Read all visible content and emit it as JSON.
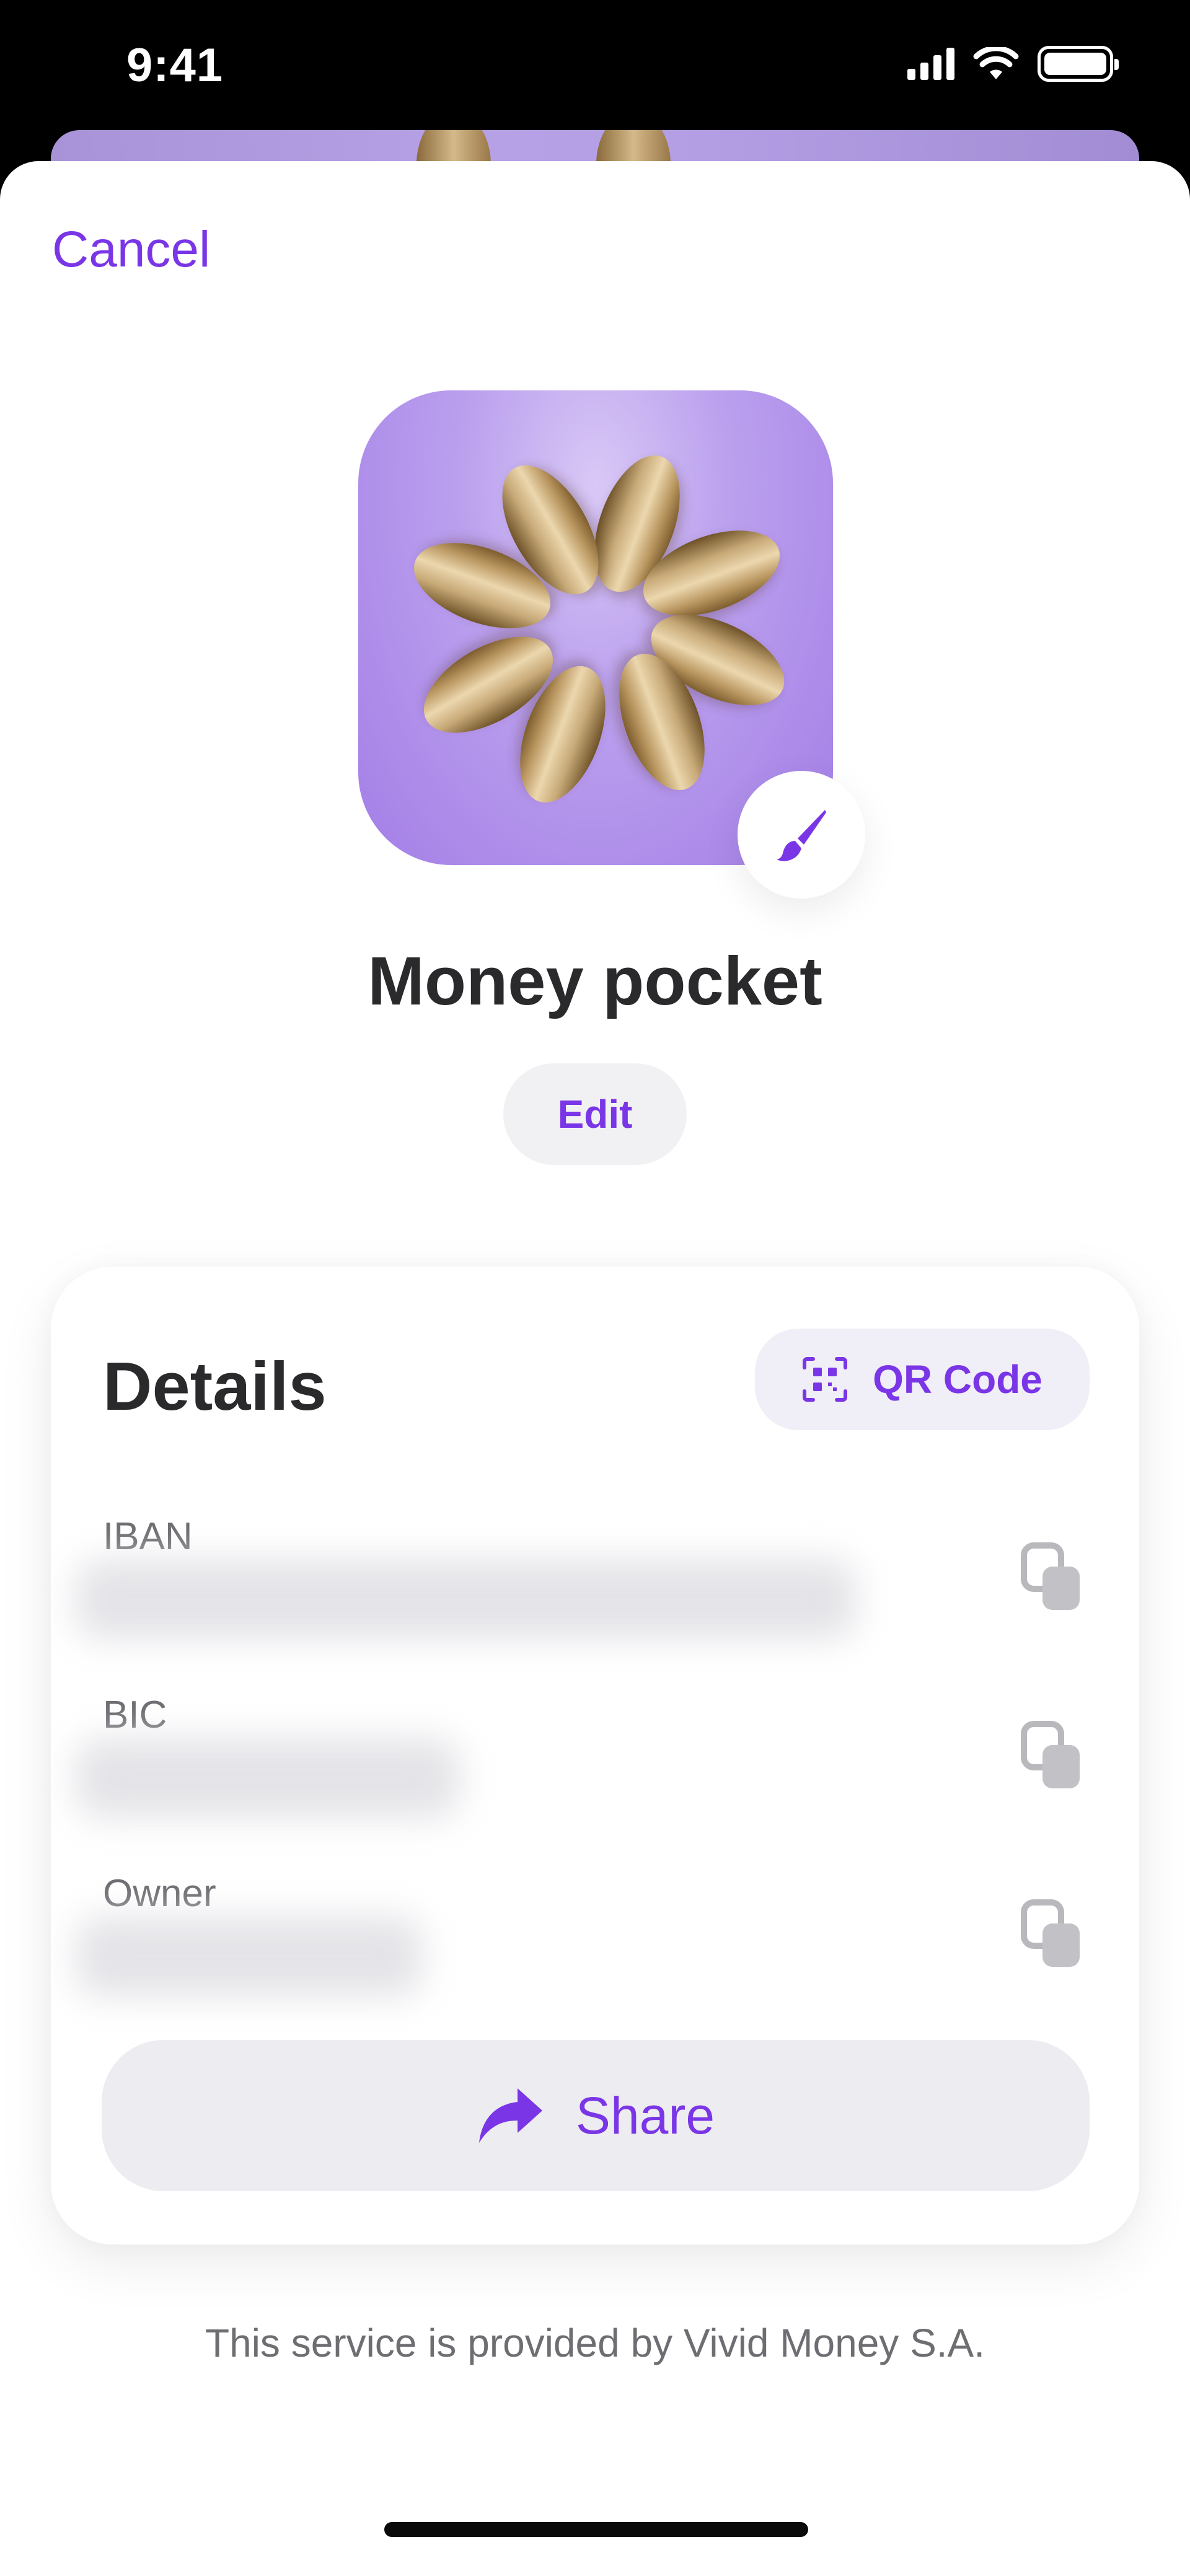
{
  "status_bar": {
    "time": "9:41"
  },
  "header": {
    "cancel_label": "Cancel"
  },
  "pocket": {
    "title": "Money pocket",
    "edit_label": "Edit"
  },
  "details": {
    "title": "Details",
    "qr_label": "QR Code",
    "fields": [
      {
        "label": "IBAN"
      },
      {
        "label": "BIC"
      },
      {
        "label": "Owner"
      }
    ],
    "share_label": "Share"
  },
  "footer": {
    "note": "This service is provided by Vivid Money S.A."
  },
  "colors": {
    "accent": "#7a36e6",
    "text": "#2a2a2c",
    "muted": "#6d6d72",
    "chip_bg": "#f1f1f4"
  }
}
